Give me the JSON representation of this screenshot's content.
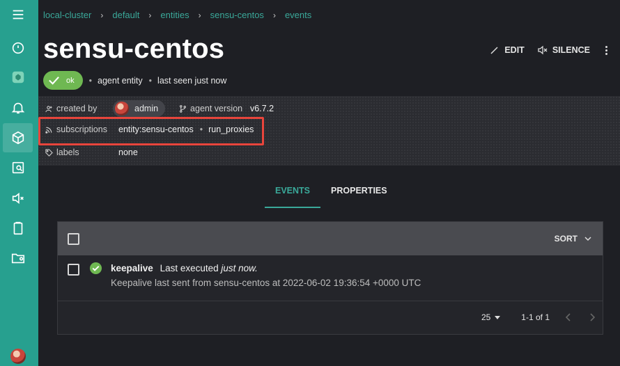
{
  "breadcrumb": [
    "local-cluster",
    "default",
    "entities",
    "sensu-centos",
    "events"
  ],
  "entity": {
    "name": "sensu-centos",
    "status": "ok",
    "class": "agent entity",
    "last_seen": "last seen just now"
  },
  "actions": {
    "edit": "EDIT",
    "silence": "SILENCE"
  },
  "meta": {
    "created_by_label": "created by",
    "created_by": "admin",
    "agent_version_label": "agent version",
    "agent_version": "v6.7.2",
    "subscriptions_label": "subscriptions",
    "subscriptions": [
      "entity:sensu-centos",
      "run_proxies"
    ],
    "labels_label": "labels",
    "labels": "none"
  },
  "tabs": [
    {
      "label": "EVENTS",
      "active": true
    },
    {
      "label": "PROPERTIES",
      "active": false
    }
  ],
  "events": {
    "sort_label": "SORT",
    "rows": [
      {
        "check": "keepalive",
        "status_text": "Last executed",
        "when": "just now.",
        "output": "Keepalive last sent from sensu-centos at 2022-06-02 19:36:54 +0000 UTC"
      }
    ],
    "per_page": "25",
    "range": "1-1 of 1"
  },
  "colors": {
    "sidebar": "#27a08f",
    "accent": "#3aa99a",
    "ok": "#6fb852",
    "highlight": "#e8453c"
  }
}
